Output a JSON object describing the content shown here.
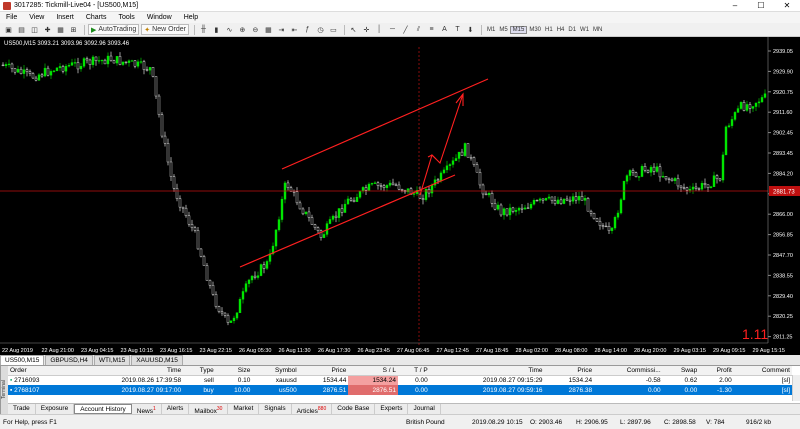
{
  "window": {
    "title": "3017285: Tickmill-Live04 - [US500,M15]"
  },
  "menu": [
    "File",
    "View",
    "Insert",
    "Charts",
    "Tools",
    "Window",
    "Help"
  ],
  "toolbar": {
    "autotrading_label": "AutoTrading",
    "new_order_label": "New Order",
    "timeframes": [
      "M1",
      "M5",
      "M15",
      "M30",
      "H1",
      "H4",
      "D1",
      "W1",
      "MN"
    ],
    "active_timeframe": "M15"
  },
  "chart": {
    "header": "US500,M15  3093.21 3093.96 3092.96 3093.46",
    "watermark": "1.11",
    "current_price_label": "2881.73",
    "price_axis": [
      "2939.05",
      "2929.90",
      "2920.75",
      "2911.60",
      "2902.45",
      "2893.45",
      "2884.20",
      "2875.15",
      "2866.00",
      "2856.85",
      "2847.70",
      "2838.55",
      "2829.40",
      "2820.25",
      "2811.25"
    ],
    "time_axis": [
      "22 Aug 2019",
      "22 Aug 21:00",
      "23 Aug 04:15",
      "23 Aug 10:15",
      "23 Aug 16:15",
      "23 Aug 22:15",
      "26 Aug 05:30",
      "26 Aug 11:30",
      "26 Aug 17:30",
      "26 Aug 23:45",
      "27 Aug 06:45",
      "27 Aug 12:45",
      "27 Aug 18:45",
      "28 Aug 02:00",
      "28 Aug 08:00",
      "28 Aug 14:00",
      "28 Aug 20:00",
      "29 Aug 03:15",
      "29 Aug 09:15",
      "29 Aug 15:15"
    ],
    "colors": {
      "bull": "#00e600",
      "bear": "#ffffff",
      "channel": "#ff2020",
      "hline": "#c01010",
      "axis_text": "#ffffff"
    }
  },
  "chart_tabs": [
    "US500,M15",
    "GBPUSD,H4",
    "WTI,M15",
    "XAUUSD,M15"
  ],
  "orders": {
    "columns": [
      "Order",
      "Time",
      "Type",
      "Size",
      "Symbol",
      "Price",
      "S / L",
      "T / P",
      "Time",
      "Price",
      "Commissi...",
      "Swap",
      "Profit",
      "Comment"
    ],
    "rows": [
      [
        "2716093",
        "2019.08.26 17:39:58",
        "sell",
        "0.10",
        "xauusd",
        "1534.44",
        "1534.24",
        "0.00",
        "2019.08.27 09:15:29",
        "1534.24",
        "-0.58",
        "0.62",
        "2.00",
        "[sl]"
      ],
      [
        "2768107",
        "2019.08.27 09:17:00",
        "buy",
        "10.00",
        "us500",
        "2876.51",
        "2876.51",
        "0.00",
        "2019.08.27 09:59:16",
        "2876.38",
        "0.00",
        "0.00",
        "-1.30",
        "[sl]"
      ]
    ]
  },
  "terminal_label": "Terminal",
  "bottom_tabs": [
    {
      "label": "Trade",
      "badge": ""
    },
    {
      "label": "Exposure",
      "badge": ""
    },
    {
      "label": "Account History",
      "badge": ""
    },
    {
      "label": "News",
      "badge": "1"
    },
    {
      "label": "Alerts",
      "badge": ""
    },
    {
      "label": "Mailbox",
      "badge": "30"
    },
    {
      "label": "Market",
      "badge": ""
    },
    {
      "label": "Signals",
      "badge": ""
    },
    {
      "label": "Articles",
      "badge": "880"
    },
    {
      "label": "Code Base",
      "badge": ""
    },
    {
      "label": "Experts",
      "badge": ""
    },
    {
      "label": "Journal",
      "badge": ""
    }
  ],
  "status": {
    "help": "For Help, press F1",
    "profile": "British Pound",
    "datetime": "2019.08.29 10:15",
    "open": "O: 2903.46",
    "high": "H: 2906.95",
    "low": "L: 2897.96",
    "close": "C: 2898.58",
    "volume": "V: 784",
    "connection": "916/2 kb"
  }
}
